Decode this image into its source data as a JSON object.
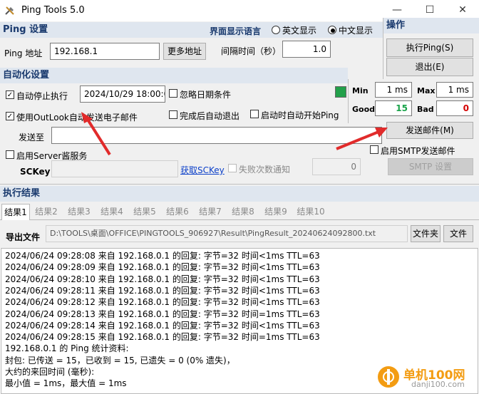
{
  "window": {
    "title": "Ping Tools 5.0",
    "minimize": "—",
    "maximize": "☐",
    "close": "✕"
  },
  "ping_settings": {
    "header": "Ping 设置",
    "address_label": "Ping 地址",
    "address_value": "192.168.1",
    "more_button": "更多地址",
    "interval_label": "间隔时间（秒）",
    "interval_value": "1.0"
  },
  "language": {
    "label": "界面显示语言",
    "option_en": "英文显示",
    "option_cn": "中文显示",
    "selected": "中文显示"
  },
  "operations": {
    "header": "操作",
    "run_button": "执行Ping(S)",
    "exit_button": "退出(E)"
  },
  "automation": {
    "header": "自动化设置",
    "auto_stop_label": "自动停止执行",
    "auto_stop_checked": true,
    "datetime_value": "2024/10/29 18:00:00",
    "ignore_date_label": "忽略日期条件",
    "ignore_date_checked": false,
    "use_outlook_label": "使用OutLook自动发送电子邮件",
    "use_outlook_checked": true,
    "exit_after_label": "完成后自动退出",
    "start_ping_label": "启动时自动开始Ping",
    "send_to_label": "发送至",
    "send_to_value": "",
    "send_mail_button": "发送邮件(M)",
    "server_label": "启用Server酱服务",
    "sckey_label": "SCKey",
    "sckey_value": "",
    "get_sckey_link": "获取SCKey",
    "fail_notify_label": "失败次数通知",
    "fail_notify_value": "0",
    "smtp_enable_label": "启用SMTP发送邮件",
    "smtp_settings_button": "SMTP 设置"
  },
  "stats": {
    "min_label": "Min",
    "min_value": "1 ms",
    "max_label": "Max",
    "max_value": "1 ms",
    "good_label": "Good",
    "good_value": "15",
    "bad_label": "Bad",
    "bad_value": "0",
    "good_color": "#1aa34a",
    "bad_color": "#d40000",
    "indicator_color": "#22a04a"
  },
  "results": {
    "header": "执行结果",
    "tabs": [
      "结果1",
      "结果2",
      "结果3",
      "结果4",
      "结果5",
      "结果6",
      "结果7",
      "结果8",
      "结果9",
      "结果10"
    ],
    "active_tab": "结果1",
    "export_label": "导出文件",
    "export_path": "D:\\TOOLS\\桌面\\OFFICE\\PINGTOOLS_906927\\Result\\PingResult_20240624092800.txt",
    "folder_button": "文件夹",
    "file_button": "文件",
    "lines": [
      "2024/06/24 09:28:08  来自 192.168.0.1 的回复: 字节=32 时间<1ms TTL=63",
      "2024/06/24 09:28:09  来自 192.168.0.1 的回复: 字节=32 时间<1ms TTL=63",
      "2024/06/24 09:28:10  来自 192.168.0.1 的回复: 字节=32 时间<1ms TTL=63",
      "2024/06/24 09:28:11  来自 192.168.0.1 的回复: 字节=32 时间<1ms TTL=63",
      "2024/06/24 09:28:12  来自 192.168.0.1 的回复: 字节=32 时间<1ms TTL=63",
      "2024/06/24 09:28:13  来自 192.168.0.1 的回复: 字节=32 时间=1ms TTL=63",
      "2024/06/24 09:28:14  来自 192.168.0.1 的回复: 字节=32 时间<1ms TTL=63",
      "2024/06/24 09:28:15  来自 192.168.0.1 的回复: 字节=32 时间=1ms TTL=63",
      "192.168.0.1 的 Ping 统计资料:",
      "  封包: 已传送 = 15，已收到 = 15, 已遗失 = 0 (0% 遗失)，",
      "  大约的来回时间 (毫秒):",
      "  最小值 = 1ms，最大值 = 1ms"
    ]
  },
  "watermark": {
    "text": "单机100网",
    "url": "danji100.com"
  }
}
